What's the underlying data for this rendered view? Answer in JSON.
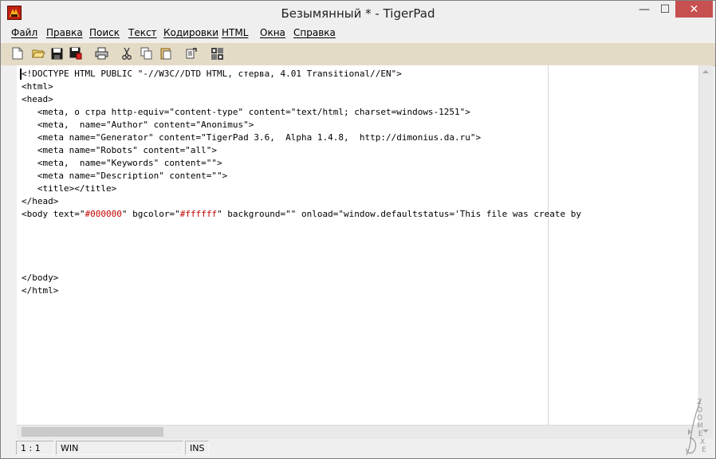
{
  "window": {
    "title": "Безымянный * - TigerPad",
    "controls": {
      "minimize": "—",
      "maximize": "☐",
      "close": "✕"
    }
  },
  "menu": [
    {
      "label": "Файл"
    },
    {
      "label": "Правка"
    },
    {
      "label": "Поиск"
    },
    {
      "label": "Текст"
    },
    {
      "label": "Кодировки"
    },
    {
      "label": "HTML"
    },
    {
      "label": "Окна"
    },
    {
      "label": "Справка"
    }
  ],
  "toolbar": {
    "buttons": [
      "new-file-icon",
      "open-folder-icon",
      "save-icon",
      "save-all-icon",
      "print-icon",
      "cut-icon",
      "copy-icon",
      "paste-icon",
      "replace-icon",
      "find-icon"
    ]
  },
  "editor": {
    "lines": [
      "<!DOCTYPE HTML PUBLIC \"-//W3C//DTD HTML, стерва, 4.01 Transitional//EN\">",
      "<html>",
      "<head>",
      "   <meta, о стра http-equiv=\"content-type\" content=\"text/html; charset=windows-1251\">",
      "   <meta,  name=\"Author\" content=\"Anonimus\">",
      "   <meta name=\"Generator\" content=\"TigerPad 3.6,  Alpha 1.4.8,  http://dimonius.da.ru\">",
      "   <meta name=\"Robots\" content=\"all\">",
      "   <meta,  name=\"Keywords\" content=\"\">",
      "   <meta name=\"Description\" content=\"\">",
      "   <title></title>",
      "</head>",
      "<body text=\"#000000\" bgcolor=\"#ffffff\" background=\"\" onload=\"window.defaultstatus='This file was create by",
      "",
      "",
      "",
      "",
      "</body>",
      "</html>"
    ],
    "highlight_color": "#c40000"
  },
  "status": {
    "position": "1 : 1",
    "encoding": "WIN",
    "mode": "INS"
  },
  "watermark": "ZOOMEXE"
}
